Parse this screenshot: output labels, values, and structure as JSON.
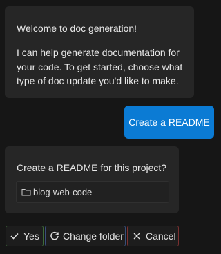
{
  "welcome": {
    "title": "Welcome to doc generation!",
    "body": "I can help generate documentation for your code. To get started, choose what type of doc update you'd like to make."
  },
  "user_message": {
    "text": "Create a README"
  },
  "confirm": {
    "question": "Create a README for this project?",
    "folder": {
      "icon": "folder-icon",
      "name": "blog-web-code"
    }
  },
  "actions": {
    "yes": {
      "label": "Yes",
      "icon": "check-icon",
      "border_color": "#3e6b3a"
    },
    "change_folder": {
      "label": "Change folder",
      "icon": "refresh-icon",
      "border_color": "#3a4e7a"
    },
    "cancel": {
      "label": "Cancel",
      "icon": "close-icon",
      "border_color": "#7a3030"
    }
  },
  "colors": {
    "background": "#161616",
    "bubble": "#262626",
    "accent": "#0b7bd4"
  }
}
